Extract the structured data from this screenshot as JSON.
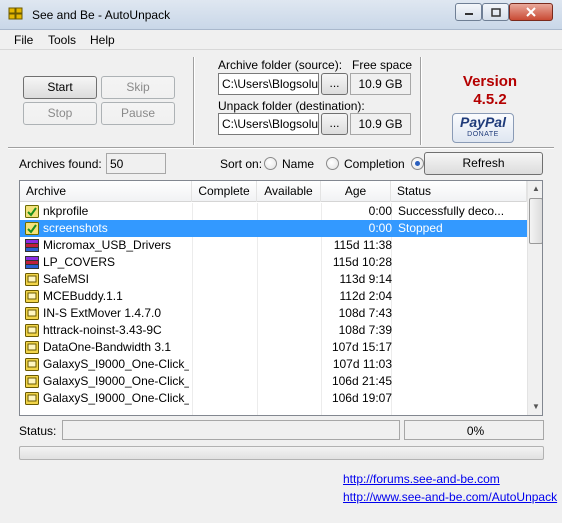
{
  "window": {
    "title": "See and Be - AutoUnpack",
    "minimize_icon": "minimize-icon",
    "maximize_icon": "maximize-icon",
    "close_icon": "close-icon"
  },
  "menu": {
    "file": "File",
    "tools": "Tools",
    "help": "Help"
  },
  "controls": {
    "start": "Start",
    "skip": "Skip",
    "stop": "Stop",
    "pause": "Pause"
  },
  "archive_folder": {
    "label": "Archive folder (source):",
    "value": "C:\\Users\\Blogsolute",
    "browse": "...",
    "free_space_label": "Free space",
    "free_space": "10.9 GB"
  },
  "unpack_folder": {
    "label": "Unpack folder (destination):",
    "value": "C:\\Users\\Blogsolute",
    "browse": "...",
    "free_space": "10.9 GB"
  },
  "version": {
    "label": "Version",
    "number": "4.5.2"
  },
  "paypal": {
    "logo": "PayPal",
    "donate": "DONATE"
  },
  "archives_found": {
    "label": "Archives found:",
    "value": "50"
  },
  "sort": {
    "label": "Sort on:",
    "options": [
      "Name",
      "Completion"
    ],
    "selected": "Refresh"
  },
  "refresh": "Refresh",
  "list": {
    "columns": [
      "Archive",
      "Complete",
      "Available",
      "Age",
      "Status"
    ],
    "rows": [
      {
        "name": "nkprofile",
        "age": "0:00",
        "status": "Successfully deco...",
        "icon": "archive-ok-icon",
        "selected": false
      },
      {
        "name": "screenshots",
        "age": "0:00",
        "status": "Stopped",
        "icon": "archive-ok-icon",
        "selected": true
      },
      {
        "name": "Micromax_USB_Drivers",
        "age": "115d 11:38",
        "status": "",
        "icon": "rar-archive-icon",
        "selected": false
      },
      {
        "name": "LP_COVERS",
        "age": "115d 10:28",
        "status": "",
        "icon": "rar-archive-icon",
        "selected": false
      },
      {
        "name": "SafeMSI",
        "age": "113d 9:14",
        "status": "",
        "icon": "zip-archive-icon",
        "selected": false
      },
      {
        "name": "MCEBuddy.1.1",
        "age": "112d 2:04",
        "status": "",
        "icon": "zip-archive-icon",
        "selected": false
      },
      {
        "name": "IN-S ExtMover 1.4.7.0",
        "age": "108d 7:43",
        "status": "",
        "icon": "zip-archive-icon",
        "selected": false
      },
      {
        "name": "httrack-noinst-3.43-9C",
        "age": "108d 7:39",
        "status": "",
        "icon": "zip-archive-icon",
        "selected": false
      },
      {
        "name": "DataOne-Bandwidth 3.1",
        "age": "107d 15:17",
        "status": "",
        "icon": "zip-archive-icon",
        "selected": false
      },
      {
        "name": "GalaxyS_I9000_One-Click_...",
        "age": "107d 11:03",
        "status": "",
        "icon": "zip-archive-icon",
        "selected": false
      },
      {
        "name": "GalaxyS_I9000_One-Click_...",
        "age": "106d 21:45",
        "status": "",
        "icon": "zip-archive-icon",
        "selected": false
      },
      {
        "name": "GalaxyS_I9000_One-Click_...",
        "age": "106d 19:07",
        "status": "",
        "icon": "zip-archive-icon",
        "selected": false
      }
    ]
  },
  "status": {
    "label": "Status:",
    "text": "",
    "percent": "0%",
    "progress": 0
  },
  "links": {
    "forums": "http://forums.see-and-be.com",
    "site": "http://www.see-and-be.com/AutoUnpack"
  },
  "colors": {
    "accent": "#3399ff",
    "version": "#b40000",
    "link": "#0000ee",
    "progress": "#37c13f"
  }
}
